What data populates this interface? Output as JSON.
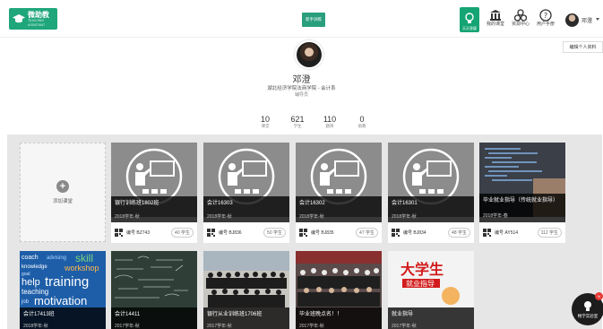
{
  "header": {
    "logo_title": "微助教",
    "logo_sub": "TEACHING ASSISTANT",
    "center_badge": "新手训练",
    "green_btn_label": "天天答疑",
    "nav": [
      {
        "label": "我的课堂",
        "icon": "classroom-icon"
      },
      {
        "label": "资源中心",
        "icon": "resource-icon"
      },
      {
        "label": "用户手册",
        "icon": "help-icon"
      }
    ],
    "user_name": "邓澄",
    "tooltip": "编辑个人资料"
  },
  "profile": {
    "name": "邓澄",
    "school": "湖北经济学院法商学院 - 会计系",
    "role": "辅导员"
  },
  "stats": [
    {
      "num": "10",
      "label": "课堂"
    },
    {
      "num": "621",
      "label": "学生"
    },
    {
      "num": "110",
      "label": "题目"
    },
    {
      "num": "0",
      "label": "助教"
    }
  ],
  "add_card_label": "添加课堂",
  "courses": [
    {
      "title": "银行训练班1802班",
      "term": "2018学年-秋",
      "code": "编号 BZ743",
      "count": "40 学生"
    },
    {
      "title": "会计16303",
      "term": "2018学年-秋",
      "code": "编号 BJ836",
      "count": "50 学生"
    },
    {
      "title": "会计16302",
      "term": "2018学年-秋",
      "code": "编号 BJ835",
      "count": "47 学生"
    },
    {
      "title": "会计16301",
      "term": "2018学年-秋",
      "code": "编号 BJ834",
      "count": "48 学生"
    },
    {
      "title": "毕业就业指导（传统就业指导）",
      "term": "2018学年-春",
      "code": "编号 AY514",
      "count": "112 学生"
    }
  ],
  "courses_row2": [
    {
      "title": "会计17413班",
      "term": "2018学年-秋"
    },
    {
      "title": "会计14411",
      "term": "2017学年-秋"
    },
    {
      "title": "银行从业训练班1706班",
      "term": "2017学年-秋"
    },
    {
      "title": "毕业班晚点名！！",
      "term": "2017学年-秋"
    },
    {
      "title": "就业指导",
      "term": "2017学年-秋"
    }
  ],
  "cover_texts": {
    "skills": [
      "coach",
      "advising",
      "skill",
      "knowledge",
      "workshop",
      "goal",
      "help",
      "training",
      "teaching",
      "job",
      "motivation"
    ],
    "book_title": "大学生",
    "book_sub": "就业指导"
  },
  "float_button": {
    "label": "畅学实验室",
    "badge": "N"
  },
  "colors": {
    "brand": "#1fa67a",
    "card_overlay": "#1a1a1a",
    "page_bg": "#e6e6e6"
  }
}
